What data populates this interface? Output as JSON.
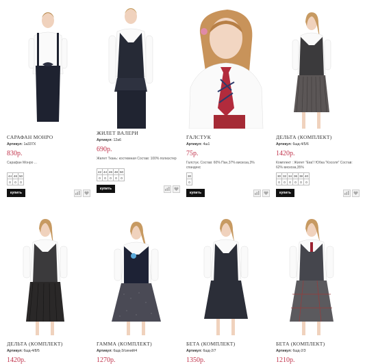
{
  "currency": "р.",
  "buy_label": "купить",
  "sku_label": "Артикул:",
  "icons": [
    "compare-icon",
    "wishlist-heart-icon"
  ],
  "products": [
    {
      "name": "САРАФАН МОНРО",
      "sku": "1а337Х",
      "price": "830р.",
      "desc": "Сарафан Монро ...",
      "sizes": [
        "44",
        "46",
        "50"
      ],
      "qty": [
        "0",
        "0",
        "0"
      ]
    },
    {
      "name": "ЖИЛЕТ ВАЛЕРИ",
      "sku": "12а6",
      "price": "690р.",
      "desc": "Жилет Ткань: костюмная Состав: 100% полиэстер",
      "sizes": [
        "42",
        "44",
        "46",
        "48",
        "50"
      ],
      "qty": [
        "0",
        "0",
        "0",
        "0",
        "0"
      ]
    },
    {
      "name": "ГАЛСТУК",
      "sku": "4ш1",
      "price": "75р.",
      "desc": "Галстук. Состав: 60% Пан,37% вискоза,3% спандекс",
      "sizes": [
        "30"
      ],
      "qty": [
        "0"
      ]
    },
    {
      "name": "ДЕЛЬТА (КОМПЛЕКТ)",
      "sku": "6шд-4/5/6",
      "price": "1420р.",
      "desc": "Комплект : Жилет \"Ева\"/ Юбка \"Косоля\" Состав: 62% вискоза,35%",
      "sizes": [
        "30",
        "32",
        "34",
        "36",
        "38",
        "40"
      ],
      "qty": [
        "0",
        "0",
        "0",
        "0",
        "0",
        "0"
      ]
    },
    {
      "name": "ДЕЛЬТА (КОМПЛЕКТ)",
      "sku": "6шд-4/8/5",
      "price": "1420р."
    },
    {
      "name": "ГАММА (КОМПЛЕКТ)",
      "sku": "6шд-3/синий/4",
      "price": "1270р."
    },
    {
      "name": "БЕТА (КОМПЛЕКТ)",
      "sku": "6шд-2/7",
      "price": "1350р."
    },
    {
      "name": "БЕТА (КОМПЛЕКТ)",
      "sku": "6шд-2/3",
      "price": "1210р."
    }
  ]
}
